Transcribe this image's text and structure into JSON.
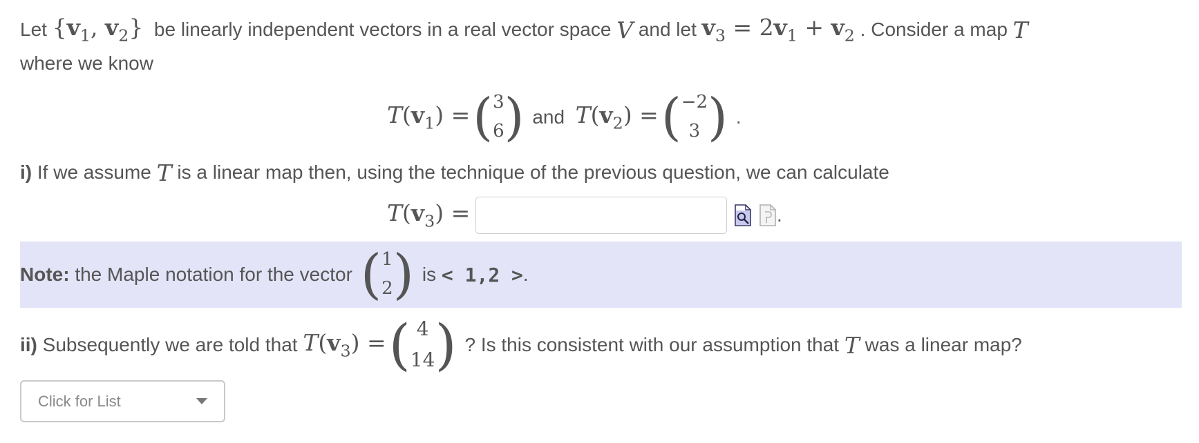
{
  "intro": {
    "let": "Let",
    "set_open": "{",
    "v1": "v",
    "v1_sub": "1",
    "comma": ",",
    "v2": "v",
    "v2_sub": "2",
    "set_close": "}",
    "text1": "be linearly independent vectors in a real vector space",
    "V": "V",
    "text2": "and let",
    "v3": "v",
    "v3_sub": "3",
    "eq": "= 2",
    "rhs_v1": "v",
    "rhs_v1_sub": "1",
    "plus": " + ",
    "rhs_v2": "v",
    "rhs_v2_sub": "2",
    "text3": ". Consider a map",
    "T": "T",
    "line2": "where we know"
  },
  "known_maps": {
    "T": "T",
    "v": "v",
    "sub1": "1",
    "sub2": "2",
    "eq": "=",
    "vec1": [
      "3",
      "6"
    ],
    "and": "and",
    "vec2": [
      "−2",
      "3"
    ],
    "period": "."
  },
  "part_i": {
    "label": "i)",
    "text_a": "If we assume",
    "T": "T",
    "text_b": "is a linear map then, using the technique of the previous question, we can calculate",
    "lhs_T": "T",
    "lhs_v": "v",
    "lhs_sub": "3",
    "eq": "=",
    "input_value": "",
    "preview_icon": "preview-icon",
    "help_icon": "help-document-icon",
    "trailing": "."
  },
  "note": {
    "label": "Note:",
    "text": "the Maple notation for the vector",
    "vec": [
      "1",
      "2"
    ],
    "is": "is",
    "code": "< 1,2 >",
    "period": ".",
    "bg_color": "#e4e4f9"
  },
  "part_ii": {
    "label": "ii)",
    "text_a": "Subsequently we are told that",
    "T": "T",
    "v": "v",
    "sub": "3",
    "eq": "=",
    "vec": [
      "4",
      "14"
    ],
    "text_b": "? Is this consistent with our assumption that",
    "T2": "T",
    "text_c": "was a linear map?"
  },
  "dropdown": {
    "placeholder": "Click for List",
    "icon": "chevron-down-icon"
  }
}
